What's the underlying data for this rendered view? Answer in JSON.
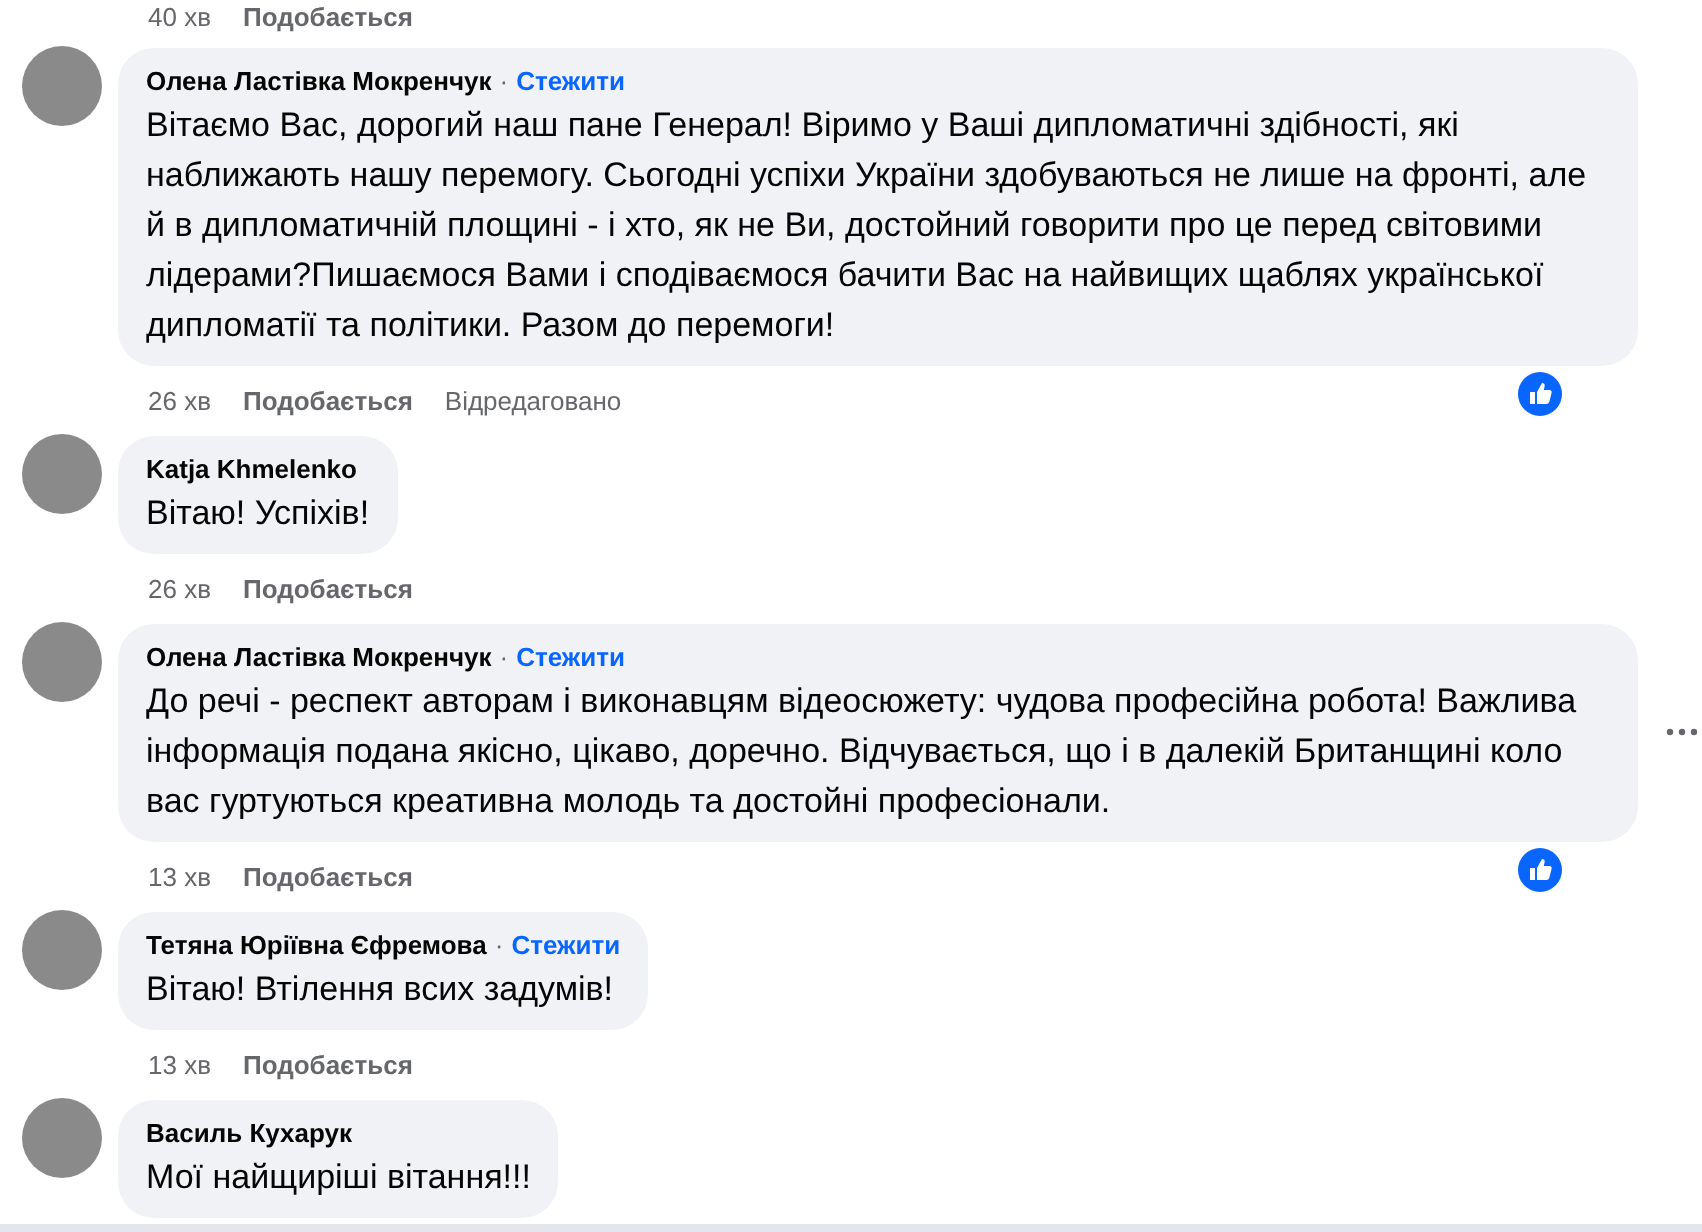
{
  "top_meta": {
    "time": "40 хв",
    "like": "Подобається"
  },
  "comments": [
    {
      "author": "Олена Ластівка Мокренчук",
      "separator": "·",
      "follow": "Стежити",
      "text": "Вітаємо Вас, дорогий наш пане Генерал! Віримо у Ваші дипломатичні здібності, які наближають нашу перемогу. Сьогодні успіхи України здобуваються не лише на фронті, але й в дипломатичній площині - і хто, як не Ви, достойний говорити про це перед світовими лідерами?Пишаємося Вами і сподіваємося бачити Вас на найвищих щаблях української дипломатії та політики. Разом до перемоги!",
      "time": "26 хв",
      "like": "Подобається",
      "edited": "Відредаговано",
      "has_reaction": true,
      "more_menu": false
    },
    {
      "author": "Katja Khmelenko",
      "text": "Вітаю! Успіхів!",
      "time": "26 хв",
      "like": "Подобається",
      "has_reaction": false,
      "more_menu": false
    },
    {
      "author": "Олена Ластівка Мокренчук",
      "separator": "·",
      "follow": "Стежити",
      "text": "До речі - респект авторам і виконавцям відеосюжету: чудова професійна робота! Важлива інформація подана якісно, цікаво, доречно. Відчувається, що і в далекій Британщині коло вас гуртуються креативна молодь та достойні професіонали.",
      "time": "13 хв",
      "like": "Подобається",
      "has_reaction": true,
      "more_menu": true
    },
    {
      "author": "Тетяна Юріївна Єфремова",
      "separator": "·",
      "follow": "Стежити",
      "text": "Вітаю! Втілення всих задумів!",
      "time": "13 хв",
      "like": "Подобається",
      "has_reaction": false,
      "more_menu": false
    },
    {
      "author": "Василь Кухарук",
      "text": "Мої найщиріші вітання!!!",
      "has_reaction": false,
      "more_menu": false
    }
  ]
}
